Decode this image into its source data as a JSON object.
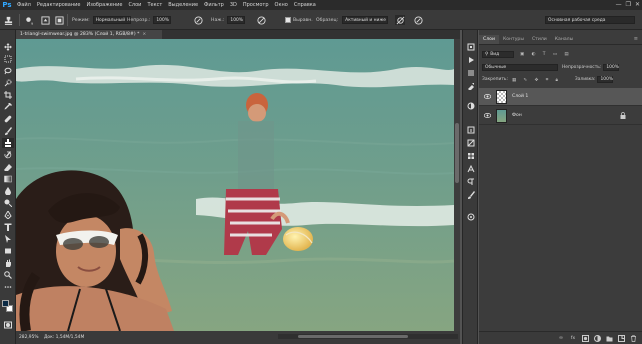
{
  "app": {
    "logo": "Ps"
  },
  "menu": [
    "Файл",
    "Редактирование",
    "Изображение",
    "Слои",
    "Текст",
    "Выделение",
    "Фильтр",
    "3D",
    "Просмотр",
    "Окно",
    "Справка"
  ],
  "window_controls": [
    "—",
    "❐",
    "✕"
  ],
  "options": {
    "brush_size": "9",
    "mode_label": "Режим:",
    "mode_value": "Нормальный",
    "opacity_label": "Непрозр.:",
    "opacity_value": "100%",
    "pressure_label": "Наж.:",
    "pressure_value": "100%",
    "aligned_label": "Выравн.",
    "sample_label": "Образец:",
    "sample_value": "Активный и ниже",
    "workspace_value": "Основная рабочая среда"
  },
  "document": {
    "tab_title": "1-triangl-swimwear.jpg @ 283% (Слой 1, RGB/8#) *",
    "zoom": "282,95%",
    "info": "Док: 1,54M/1,54M"
  },
  "layers_panel": {
    "tabs": [
      "Слои",
      "Контуры",
      "Стили",
      "Каналы"
    ],
    "filter_label": "Вид",
    "blend_mode": "Обычные",
    "opacity_label": "Непрозрачность:",
    "opacity_value": "100%",
    "lock_label": "Закрепить:",
    "fill_label": "Заливка:",
    "fill_value": "100%",
    "layers": [
      {
        "name": "Слой 1",
        "selected": true
      },
      {
        "name": "Фон",
        "selected": false,
        "locked": true
      }
    ]
  },
  "colors": {
    "accent": "#31a8ff",
    "sea": "#6f9a8a",
    "panel": "#3c3c3c"
  }
}
